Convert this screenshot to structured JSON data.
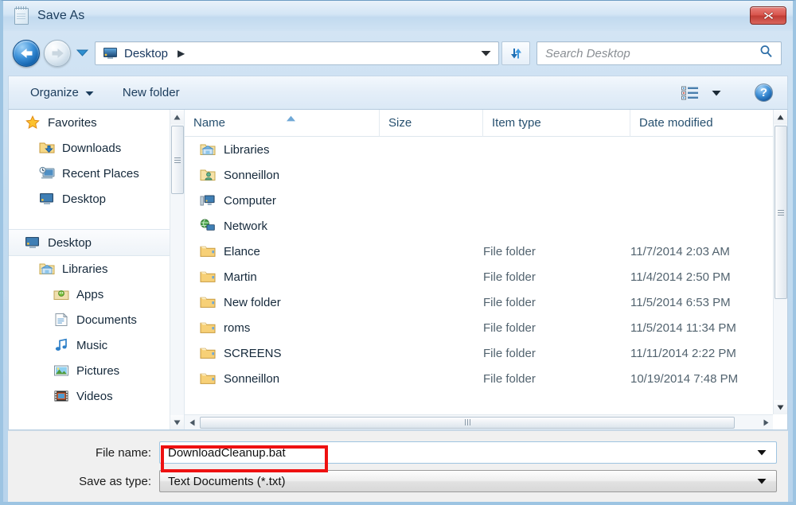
{
  "window": {
    "title": "Save As",
    "title_icon": "notepad-icon",
    "close_label": "Close"
  },
  "addressbar": {
    "back_icon": "back-arrow-icon",
    "forward_icon": "forward-arrow-icon",
    "history_icon": "recent-locations-icon",
    "breadcrumb_icon": "desktop-monitor-icon",
    "breadcrumb": "Desktop",
    "breadcrumb_separator": "▶",
    "dropdown_icon": "chevron-down-icon",
    "refresh_icon": "refresh-icon",
    "search_placeholder": "Search Desktop",
    "search_icon": "magnifier-icon"
  },
  "toolbar": {
    "organize_label": "Organize",
    "organize_caret": "▼",
    "new_folder_label": "New folder",
    "view_icon": "list-view-icon",
    "view_caret": "▼",
    "help_label": "?"
  },
  "sidebar": {
    "items": [
      {
        "label": "Favorites",
        "icon": "star-icon",
        "level": 0,
        "selected": false
      },
      {
        "label": "Downloads",
        "icon": "downloads-icon",
        "level": 1,
        "selected": false
      },
      {
        "label": "Recent Places",
        "icon": "recent-places-icon",
        "level": 1,
        "selected": false
      },
      {
        "label": "Desktop",
        "icon": "desktop-icon",
        "level": 1,
        "selected": false
      },
      {
        "label": "Desktop",
        "icon": "desktop-icon",
        "level": 0,
        "selected": true
      },
      {
        "label": "Libraries",
        "icon": "libraries-icon",
        "level": 1,
        "selected": false
      },
      {
        "label": "Apps",
        "icon": "apps-icon",
        "level": 2,
        "selected": false
      },
      {
        "label": "Documents",
        "icon": "documents-icon",
        "level": 2,
        "selected": false
      },
      {
        "label": "Music",
        "icon": "music-icon",
        "level": 2,
        "selected": false
      },
      {
        "label": "Pictures",
        "icon": "pictures-icon",
        "level": 2,
        "selected": false
      },
      {
        "label": "Videos",
        "icon": "videos-icon",
        "level": 2,
        "selected": false
      }
    ]
  },
  "filelist": {
    "columns": [
      {
        "key": "name",
        "label": "Name",
        "sorted": true,
        "sort_icon": "sort-ascending-icon"
      },
      {
        "key": "size",
        "label": "Size",
        "sorted": false
      },
      {
        "key": "type",
        "label": "Item type",
        "sorted": false
      },
      {
        "key": "date",
        "label": "Date modified",
        "sorted": false
      }
    ],
    "rows": [
      {
        "name": "Libraries",
        "icon": "libraries-icon",
        "size": "",
        "type": "",
        "date": ""
      },
      {
        "name": "Sonneillon",
        "icon": "user-folder-icon",
        "size": "",
        "type": "",
        "date": ""
      },
      {
        "name": "Computer",
        "icon": "computer-icon",
        "size": "",
        "type": "",
        "date": ""
      },
      {
        "name": "Network",
        "icon": "network-icon",
        "size": "",
        "type": "",
        "date": ""
      },
      {
        "name": "Elance",
        "icon": "folder-icon",
        "size": "",
        "type": "File folder",
        "date": "11/7/2014 2:03 AM"
      },
      {
        "name": "Martin",
        "icon": "folder-icon",
        "size": "",
        "type": "File folder",
        "date": "11/4/2014 2:50 PM"
      },
      {
        "name": "New folder",
        "icon": "folder-icon",
        "size": "",
        "type": "File folder",
        "date": "11/5/2014 6:53 PM"
      },
      {
        "name": "roms",
        "icon": "folder-icon",
        "size": "",
        "type": "File folder",
        "date": "11/5/2014 11:34 PM"
      },
      {
        "name": "SCREENS",
        "icon": "folder-icon",
        "size": "",
        "type": "File folder",
        "date": "11/11/2014 2:22 PM"
      },
      {
        "name": "Sonneillon",
        "icon": "folder-icon",
        "size": "",
        "type": "File folder",
        "date": "10/19/2014 7:48 PM"
      }
    ]
  },
  "footer": {
    "file_name_label": "File name:",
    "file_name_value": "DownloadCleanup.bat",
    "save_as_type_label": "Save as type:",
    "save_as_type_value": "Text Documents (*.txt)",
    "dropdown_icon": "chevron-down-icon"
  },
  "annotation": {
    "highlight_color": "#ee1111",
    "target": "file-name-input"
  }
}
